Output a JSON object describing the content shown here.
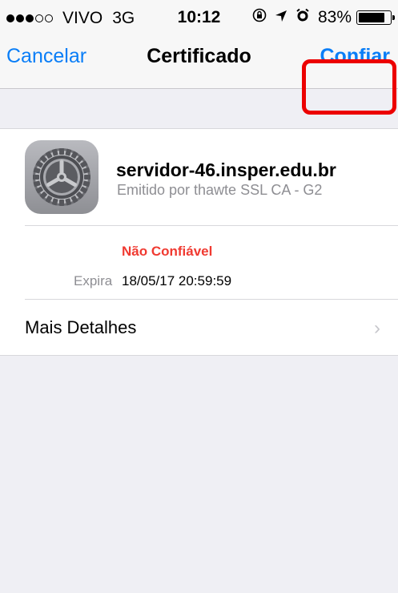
{
  "status_bar": {
    "carrier": "VIVO",
    "network": "3G",
    "time": "10:12",
    "battery": "83%",
    "battery_level": 0.83,
    "signal_bars_filled": 3,
    "signal_bars_total": 5
  },
  "nav": {
    "cancel_label": "Cancelar",
    "title": "Certificado",
    "trust_label": "Confiar",
    "accent_color": "#0a7ef7",
    "highlight_color": "#ec0000"
  },
  "certificate": {
    "name": "servidor-46.insper.edu.br",
    "issuer": "Emitido por thawte SSL CA - G2",
    "trust_status": "Não Confiável",
    "trust_status_color": "#f03a31",
    "expires_label": "Expira",
    "expires_value": "18/05/17 20:59:59",
    "icon": "settings-gear-icon"
  },
  "details": {
    "label": "Mais Detalhes",
    "chevron": "›"
  }
}
